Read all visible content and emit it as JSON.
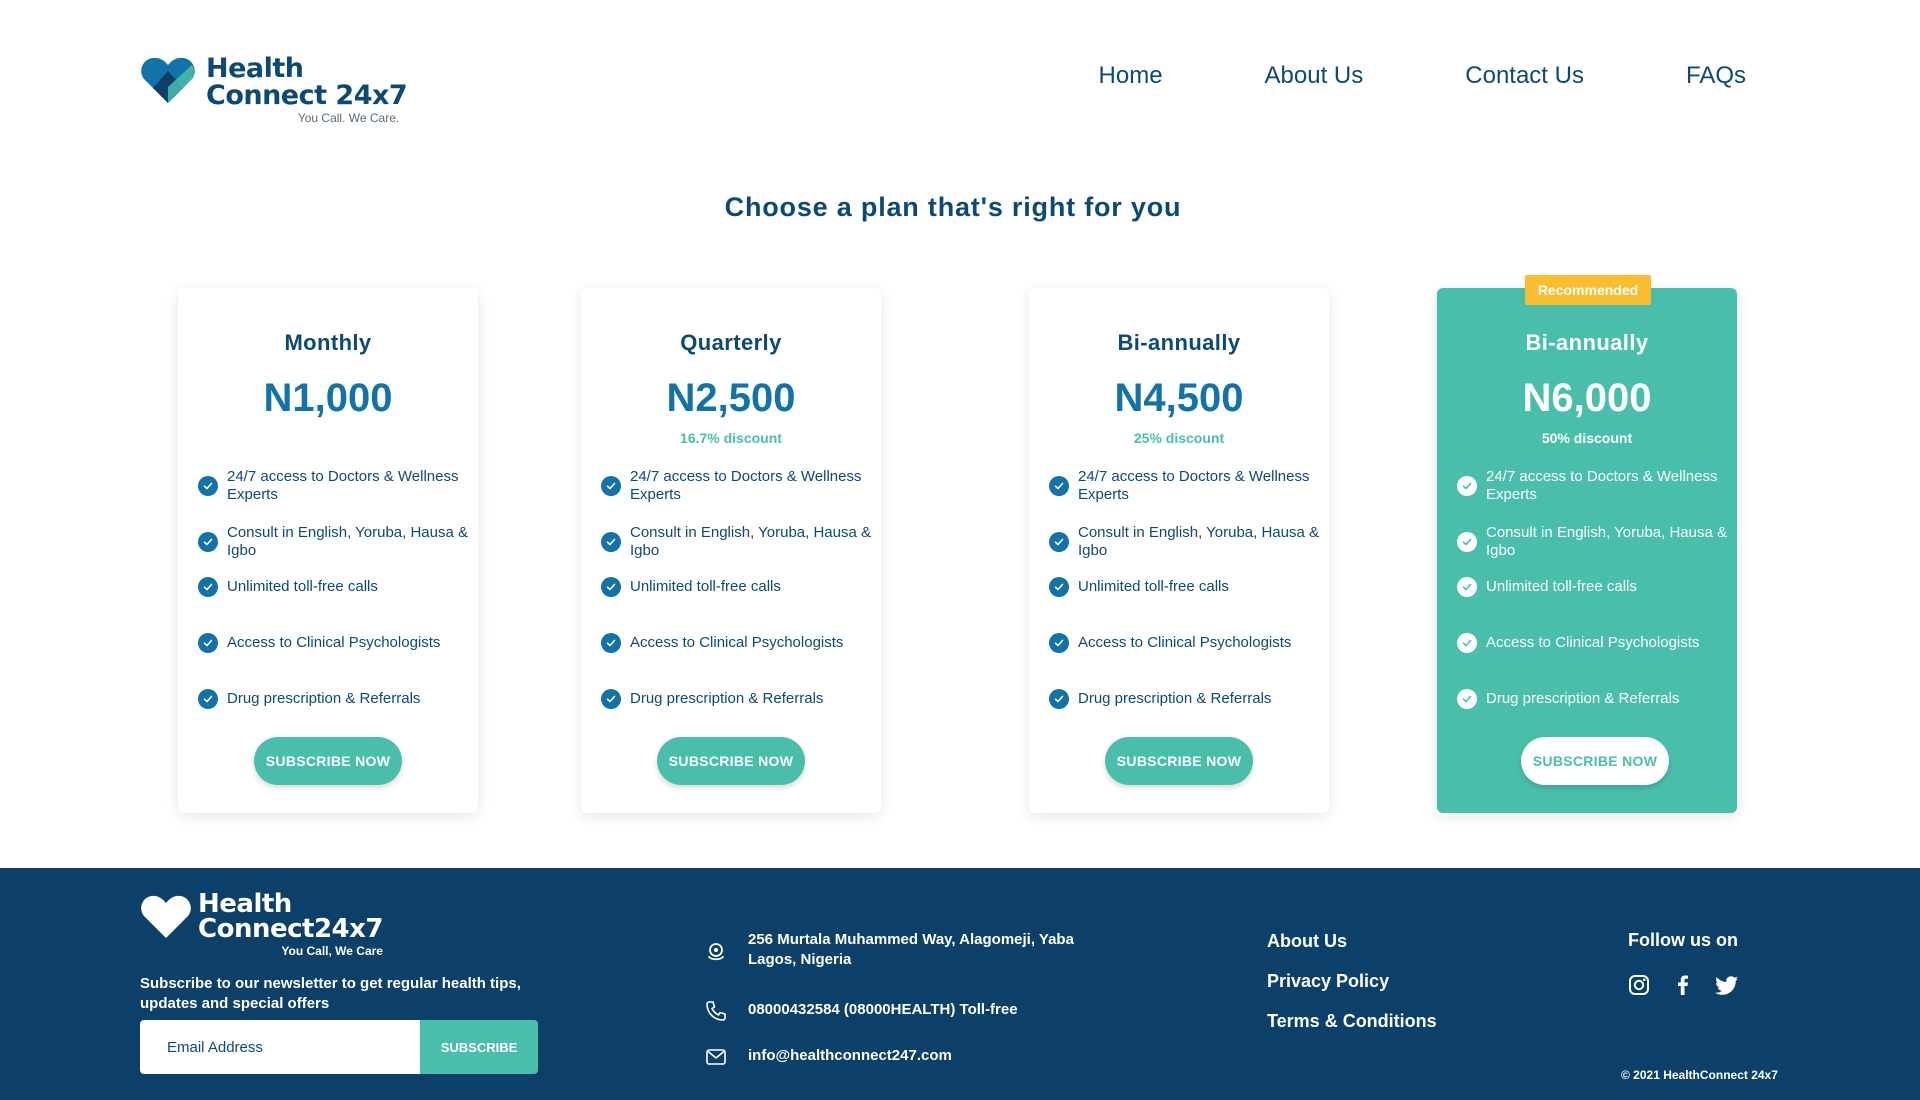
{
  "header": {
    "logo": {
      "line1": "Health",
      "line2": "Connect 24x7",
      "tagline": "You Call. We Care."
    },
    "nav": [
      {
        "label": "Home"
      },
      {
        "label": "About Us"
      },
      {
        "label": "Contact Us"
      },
      {
        "label": "FAQs"
      }
    ]
  },
  "pricing": {
    "title": "Choose a plan that's right for you",
    "plans": [
      {
        "name": "Monthly",
        "price": "N1,000",
        "discount": "",
        "features": [
          "24/7 access to Doctors & Wellness Experts",
          "Consult in English, Yoruba, Hausa & Igbo",
          "Unlimited toll-free calls",
          "Access to Clinical Psychologists",
          "Drug prescription & Referrals"
        ],
        "button": "SUBSCRIBE NOW"
      },
      {
        "name": "Quarterly",
        "price": "N2,500",
        "discount": "16.7% discount",
        "features": [
          "24/7 access to Doctors & Wellness Experts",
          "Consult in English, Yoruba, Hausa & Igbo",
          "Unlimited toll-free calls",
          "Access to Clinical Psychologists",
          "Drug prescription & Referrals"
        ],
        "button": "SUBSCRIBE NOW"
      },
      {
        "name": "Bi-annually",
        "price": "N4,500",
        "discount": "25% discount",
        "features": [
          "24/7 access to Doctors & Wellness Experts",
          "Consult in English, Yoruba, Hausa & Igbo",
          "Unlimited toll-free calls",
          "Access to Clinical Psychologists",
          "Drug prescription & Referrals"
        ],
        "button": "SUBSCRIBE NOW"
      },
      {
        "badge": "Recommended",
        "name": "Bi-annually",
        "price": "N6,000",
        "discount": "50% discount",
        "features": [
          "24/7 access to Doctors & Wellness Experts",
          "Consult in English, Yoruba, Hausa & Igbo",
          "Unlimited toll-free calls",
          "Access to Clinical Psychologists",
          "Drug prescription & Referrals"
        ],
        "button": "SUBSCRIBE NOW"
      }
    ]
  },
  "footer": {
    "logo": {
      "line1": "Health",
      "line2": "Connect24x7",
      "tagline": "You Call, We Care"
    },
    "newsletter_text": "Subscribe to our newsletter to get regular health tips, updates and special offers",
    "email_placeholder": "Email Address",
    "subscribe_label": "SUBSCRIBE",
    "contact": {
      "address": "256 Murtala Muhammed Way, Alagomeji, Yaba Lagos, Nigeria",
      "phone": "08000432584 (08000HEALTH) Toll-free",
      "email": "info@healthconnect247.com"
    },
    "links": [
      {
        "label": "About Us"
      },
      {
        "label": "Privacy Policy"
      },
      {
        "label": "Terms & Conditions"
      }
    ],
    "follow_label": "Follow us on",
    "socials": [
      "instagram-icon",
      "facebook-icon",
      "twitter-icon"
    ],
    "copyright": "© 2021 HealthConnect 24x7"
  },
  "colors": {
    "primary_navy": "#0c4068",
    "brand_blue": "#1372a8",
    "teal": "#49bfab",
    "badge_yellow": "#f9be2f"
  }
}
